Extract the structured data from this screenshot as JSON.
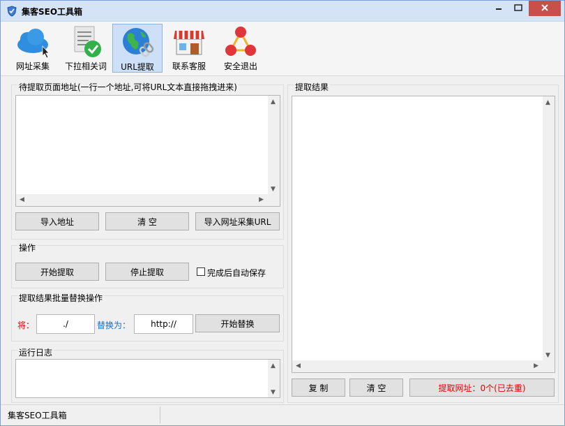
{
  "window": {
    "title": "集客SEO工具箱"
  },
  "toolbar": {
    "items": [
      {
        "label": "网址采集",
        "icon": "cloud-icon"
      },
      {
        "label": "下拉相关词",
        "icon": "document-check-icon"
      },
      {
        "label": "URL提取",
        "icon": "globe-link-icon",
        "active": true
      },
      {
        "label": "联系客服",
        "icon": "shop-icon"
      },
      {
        "label": "安全退出",
        "icon": "network-exit-icon"
      }
    ]
  },
  "left": {
    "input_group": {
      "title": "待提取页面地址(一行一个地址,可将URL文本直接拖拽进来)",
      "buttons": [
        "导入地址",
        "清 空",
        "导入网址采集URL"
      ]
    },
    "ops_group": {
      "title": "操作",
      "start_label": "开始提取",
      "stop_label": "停止提取",
      "autosave_label": "完成后自动保存"
    },
    "replace_group": {
      "title": "提取结果批量替换操作",
      "from_label": "将：",
      "from_value": "./",
      "to_label": "替换为：",
      "to_value": "http://",
      "start_label": "开始替换"
    },
    "log_group": {
      "title": "运行日志"
    }
  },
  "right": {
    "result_group": {
      "title": "提取结果",
      "copy_label": "复 制",
      "clear_label": "清 空",
      "count_label": "提取网址：0个(已去重)"
    }
  },
  "statusbar": {
    "text": "集客SEO工具箱"
  },
  "colors": {
    "accent": "#1b6ec2",
    "warning_red": "#e00000",
    "close_button": "#c7504b"
  }
}
